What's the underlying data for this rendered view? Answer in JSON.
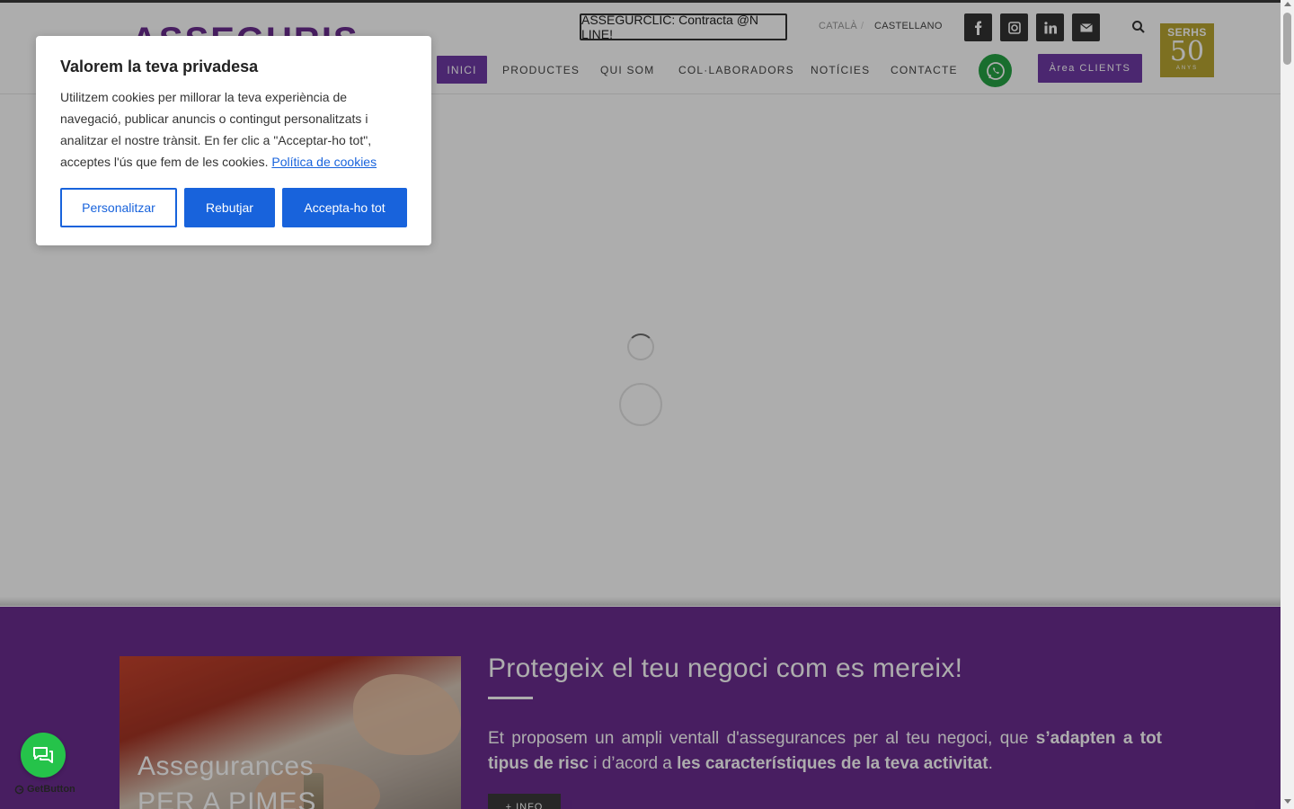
{
  "header": {
    "logo_text": "ASSEGURIS",
    "contract_button": "ASSEGURCLIC: Contracta @N LINE!",
    "languages": [
      "CATALÀ",
      "/",
      "CASTELLANO"
    ],
    "social_icons": [
      "facebook-icon",
      "instagram-icon",
      "linkedin-icon",
      "mail-icon"
    ],
    "badge": {
      "top": "SERHS",
      "number": "50",
      "sub": "ANYS"
    },
    "nav": [
      "INICI",
      "PRODUCTES",
      "QUI SOM",
      "COL·LABORADORS",
      "NOTÍCIES",
      "CONTACTE"
    ],
    "area_clients": "Àrea CLIENTS"
  },
  "section": {
    "card_title_line1": "Assegurances",
    "card_title_line2": "PER A PIMES",
    "title": "Protegeix el teu negoci com es mereix!",
    "text_part1": "Et proposem un ampli ventall d'assegurances per al teu negoci, que ",
    "text_bold1": "s’adapten a tot tipus de risc",
    "text_part2": " i d’acord a ",
    "text_bold2": "les característiques de la teva activitat",
    "text_part3": ".",
    "info_button": "+ INFO"
  },
  "cookie": {
    "title": "Valorem la teva privadesa",
    "text": "Utilitzem cookies per millorar la teva experiència de navegació, publicar anuncis o contingut personalitzats i analitzar el nostre trànsit. En fer clic a \"Acceptar-ho tot\", acceptes l'ús que fem de les cookies. ",
    "policy_link": "Política de cookies",
    "btn_customize": "Personalitzar",
    "btn_reject": "Rebutjar",
    "btn_accept": "Accepta-ho tot"
  },
  "widget": {
    "getbutton_label": "GetButton"
  },
  "colors": {
    "brand_purple": "#6b2d8f",
    "nav_active": "#6f3aa6",
    "cookie_blue": "#1863dc",
    "whatsapp_green": "#25c34a",
    "badge_gold": "#b8a532"
  }
}
